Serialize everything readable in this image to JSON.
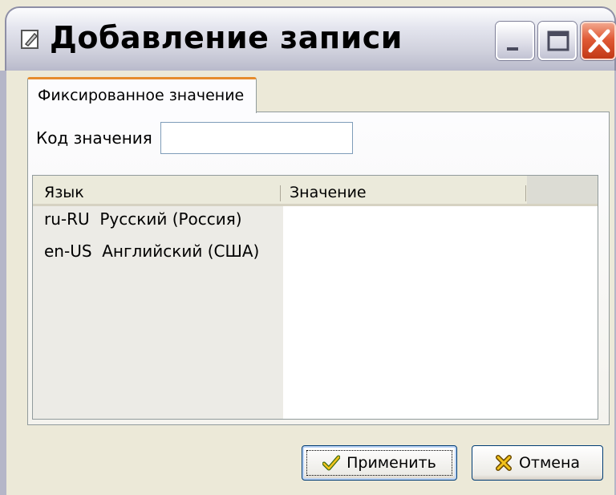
{
  "window": {
    "title": "Добавление записи",
    "buttons": {
      "minimize": "minimize-icon",
      "maximize": "maximize-icon",
      "close": "close-icon"
    }
  },
  "tabs": [
    {
      "label": "Фиксированное значение",
      "active": true
    }
  ],
  "form": {
    "code_label": "Код значения",
    "code_value": ""
  },
  "grid": {
    "columns": [
      "Язык",
      "Значение"
    ],
    "rows": [
      {
        "language": "ru-RU  Русский (Россия)",
        "value": ""
      },
      {
        "language": "en-US  Английский (США)",
        "value": ""
      }
    ]
  },
  "actions": {
    "apply_label": "Применить",
    "apply_icon": "checkmark-icon",
    "cancel_label": "Отмена",
    "cancel_icon": "cross-icon"
  },
  "colors": {
    "tab_accent": "#e68b2c",
    "close_button": "#e05a36",
    "dialog_background": "#ece9d8"
  }
}
